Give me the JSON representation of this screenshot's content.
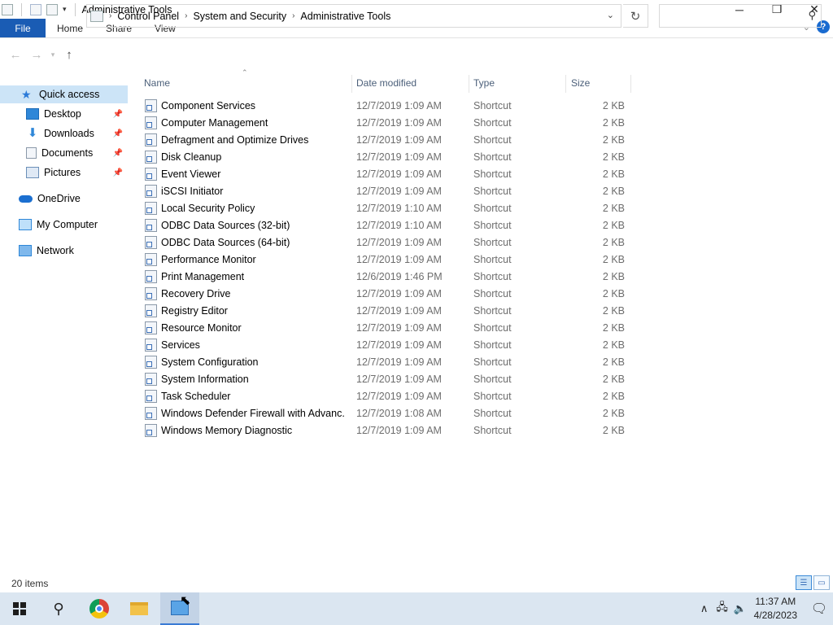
{
  "window": {
    "title": "Administrative Tools"
  },
  "ribbon": {
    "tabs": [
      "File",
      "Home",
      "Share",
      "View"
    ]
  },
  "address": {
    "crumbs": [
      "Control Panel",
      "System and Security",
      "Administrative Tools"
    ],
    "search_placeholder": ""
  },
  "nav": {
    "items": [
      {
        "label": "Quick access",
        "icon": "star-icon",
        "pinned": false,
        "selected": true
      },
      {
        "label": "Desktop",
        "icon": "desktop-icon",
        "pinned": true
      },
      {
        "label": "Downloads",
        "icon": "download-icon",
        "pinned": true
      },
      {
        "label": "Documents",
        "icon": "documents-icon",
        "pinned": true
      },
      {
        "label": "Pictures",
        "icon": "pictures-icon",
        "pinned": true
      },
      {
        "label": "OneDrive",
        "icon": "cloud-icon",
        "pinned": false
      },
      {
        "label": "My Computer",
        "icon": "computer-icon",
        "pinned": false
      },
      {
        "label": "Network",
        "icon": "network-icon",
        "pinned": false
      }
    ]
  },
  "columns": {
    "name": "Name",
    "date": "Date modified",
    "type": "Type",
    "size": "Size"
  },
  "files": [
    {
      "name": "Component Services",
      "date": "12/7/2019 1:09 AM",
      "type": "Shortcut",
      "size": "2 KB"
    },
    {
      "name": "Computer Management",
      "date": "12/7/2019 1:09 AM",
      "type": "Shortcut",
      "size": "2 KB"
    },
    {
      "name": "Defragment and Optimize Drives",
      "date": "12/7/2019 1:09 AM",
      "type": "Shortcut",
      "size": "2 KB"
    },
    {
      "name": "Disk Cleanup",
      "date": "12/7/2019 1:09 AM",
      "type": "Shortcut",
      "size": "2 KB"
    },
    {
      "name": "Event Viewer",
      "date": "12/7/2019 1:09 AM",
      "type": "Shortcut",
      "size": "2 KB"
    },
    {
      "name": "iSCSI Initiator",
      "date": "12/7/2019 1:09 AM",
      "type": "Shortcut",
      "size": "2 KB"
    },
    {
      "name": "Local Security Policy",
      "date": "12/7/2019 1:10 AM",
      "type": "Shortcut",
      "size": "2 KB"
    },
    {
      "name": "ODBC Data Sources (32-bit)",
      "date": "12/7/2019 1:10 AM",
      "type": "Shortcut",
      "size": "2 KB"
    },
    {
      "name": "ODBC Data Sources (64-bit)",
      "date": "12/7/2019 1:09 AM",
      "type": "Shortcut",
      "size": "2 KB"
    },
    {
      "name": "Performance Monitor",
      "date": "12/7/2019 1:09 AM",
      "type": "Shortcut",
      "size": "2 KB"
    },
    {
      "name": "Print Management",
      "date": "12/6/2019 1:46 PM",
      "type": "Shortcut",
      "size": "2 KB"
    },
    {
      "name": "Recovery Drive",
      "date": "12/7/2019 1:09 AM",
      "type": "Shortcut",
      "size": "2 KB"
    },
    {
      "name": "Registry Editor",
      "date": "12/7/2019 1:09 AM",
      "type": "Shortcut",
      "size": "2 KB"
    },
    {
      "name": "Resource Monitor",
      "date": "12/7/2019 1:09 AM",
      "type": "Shortcut",
      "size": "2 KB"
    },
    {
      "name": "Services",
      "date": "12/7/2019 1:09 AM",
      "type": "Shortcut",
      "size": "2 KB"
    },
    {
      "name": "System Configuration",
      "date": "12/7/2019 1:09 AM",
      "type": "Shortcut",
      "size": "2 KB"
    },
    {
      "name": "System Information",
      "date": "12/7/2019 1:09 AM",
      "type": "Shortcut",
      "size": "2 KB"
    },
    {
      "name": "Task Scheduler",
      "date": "12/7/2019 1:09 AM",
      "type": "Shortcut",
      "size": "2 KB"
    },
    {
      "name": "Windows Defender Firewall with Advanc...",
      "date": "12/7/2019 1:08 AM",
      "type": "Shortcut",
      "size": "2 KB"
    },
    {
      "name": "Windows Memory Diagnostic",
      "date": "12/7/2019 1:09 AM",
      "type": "Shortcut",
      "size": "2 KB"
    }
  ],
  "status": {
    "item_count": "20 items"
  },
  "taskbar": {
    "time": "11:37 AM",
    "date": "4/28/2023",
    "apps": [
      "start-icon",
      "search-icon",
      "chrome-icon",
      "file-explorer-icon",
      "admin-tools-icon"
    ]
  },
  "colors": {
    "accent": "#1a5cb4",
    "selection": "#cce4f7",
    "taskbar": "#dbe6f1"
  }
}
